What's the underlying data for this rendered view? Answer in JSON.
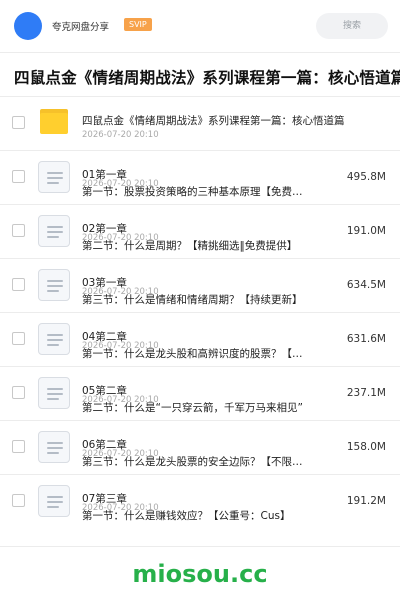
{
  "header": {
    "title": "夸克网盘分享",
    "badge": "SVIP",
    "search_placeholder": "搜索"
  },
  "page_title": "四鼠点金《情绪周期战法》系列课程第一篇：核心悟道篇",
  "folder": {
    "name": "四鼠点金《情绪周期战法》系列课程第一篇：核心悟道篇",
    "date": "2026-07-20 20:10",
    "icon": "folder-icon"
  },
  "files": [
    {
      "chapter": "01第一章",
      "date": "2026-07-20 20:10",
      "title": "第一节：股票投资策略的三种基本原理【免费提供】",
      "size": "495.8M",
      "icon": "document-icon"
    },
    {
      "chapter": "02第一章",
      "date": "2026-07-20 20:10",
      "title": "第二节：什么是周期？【精挑细选‖免费提供】",
      "size": "191.0M",
      "icon": "document-icon"
    },
    {
      "chapter": "03第一章",
      "date": "2026-07-20 20:10",
      "title": "第三节：什么是情绪和情绪周期？【持续更新】",
      "size": "634.5M",
      "icon": "document-icon"
    },
    {
      "chapter": "04第二章",
      "date": "2026-07-20 20:10",
      "title": "第一节：什么是龙头股和高辨识度的股票？【免费】",
      "size": "631.6M",
      "icon": "document-icon"
    },
    {
      "chapter": "05第二章",
      "date": "2026-07-20 20:10",
      "title": "第二节：什么是“一只穿云箭，千军万马来相见”",
      "size": "237.1M",
      "icon": "document-icon"
    },
    {
      "chapter": "06第二章",
      "date": "2026-07-20 20:10",
      "title": "第三节：什么是龙头股票的安全边际？【不限速】",
      "size": "158.0M",
      "icon": "document-icon"
    },
    {
      "chapter": "07第三章",
      "date": "2026-07-20 20:10",
      "title": "第一节：什么是赚钱效应？【公重号：Cus】",
      "size": "191.2M",
      "icon": "document-icon"
    }
  ],
  "watermark": "miosou.cc",
  "colors": {
    "avatar": "#2f7cf6",
    "badge": "#f7a24a",
    "folder": "#ffcf2e",
    "watermark": "#27b04a"
  }
}
